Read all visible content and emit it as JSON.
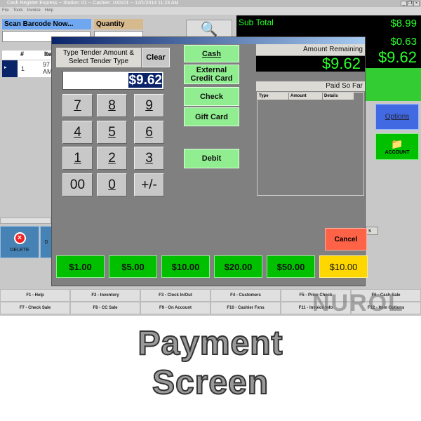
{
  "window": {
    "title": "Cash Register Express -- Station: 01 -- Cashier: 100101 -- 12/1/2014 11:23 AM",
    "menu": [
      "File",
      "Tools",
      "Invoice",
      "Help"
    ]
  },
  "main": {
    "scan_label": "Scan Barcode Now...",
    "quantity_label": "Quantity",
    "table_headers": [
      "#",
      "Ite"
    ],
    "row": {
      "num": "1",
      "item": "97\nAM"
    },
    "subtotal_label": "Sub Total",
    "subtotal": "$8.99",
    "tax": "$0.63",
    "total": "$9.62",
    "options_label": "Options",
    "account_label": "ACCOUNT",
    "delete_label": "DELETE",
    "next_btn": "D",
    "tab_fragment": "s"
  },
  "dialog": {
    "prompt": "Type Tender Amount & Select Tender Type",
    "clear": "Clear",
    "amount_value": "$9.62",
    "keys": [
      "7",
      "8",
      "9",
      "4",
      "5",
      "6",
      "1",
      "2",
      "3",
      "00",
      "0",
      "+/-"
    ],
    "tenders": [
      "Cash",
      "External Credit Card",
      "Check",
      "Gift Card",
      "Debit"
    ],
    "amount_remaining_label": "Amount Remaining",
    "amount_remaining": "$9.62",
    "paid_label": "Paid So Far",
    "paid_headers": [
      "Type",
      "Amount",
      "Details"
    ],
    "cancel": "Cancel",
    "bills": [
      "$1.00",
      "$5.00",
      "$10.00",
      "$20.00",
      "$50.00"
    ],
    "exact": "$10.00"
  },
  "fkeys": [
    "F1 - Help",
    "F2 - Inventory",
    "F3 - Clock In/Out",
    "F4 - Customers",
    "F5 - Price Check",
    "F6 - Cash Sale",
    "F7 - Check Sale",
    "F8 - CC Sale",
    "F9 - On Account",
    "F10 - Cashier Fxns",
    "F11 - Invoice Info",
    "F12 - Item Options"
  ],
  "watermark": "NUROL",
  "caption": {
    "line1": "Payment",
    "line2": "Screen"
  },
  "colors": {
    "accent_green": "#00c000",
    "tender_green": "#90ee90",
    "cancel": "#ff6347",
    "exact": "#ffd700",
    "display_text": "#2aff2a"
  }
}
